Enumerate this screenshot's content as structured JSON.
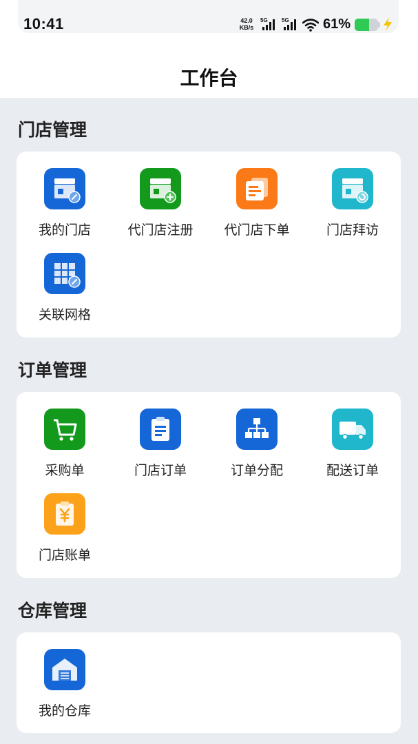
{
  "status_bar": {
    "time": "10:41",
    "net_speed_value": "42.0",
    "net_speed_unit": "KB/s",
    "sim1": "5G",
    "sim2": "5G",
    "battery_percent": "61%",
    "battery_level": 0.61
  },
  "header": {
    "title": "工作台"
  },
  "sections": [
    {
      "title": "门店管理",
      "items": [
        {
          "label": "我的门店",
          "icon": "store-link-icon",
          "color": "#1567d8"
        },
        {
          "label": "代门店注册",
          "icon": "store-add-icon",
          "color": "#139a1d"
        },
        {
          "label": "代门店下单",
          "icon": "documents-icon",
          "color": "#fb7a17"
        },
        {
          "label": "门店拜访",
          "icon": "store-visit-icon",
          "color": "#20b7cd"
        },
        {
          "label": "关联网格",
          "icon": "grid-link-icon",
          "color": "#1567d8"
        }
      ]
    },
    {
      "title": "订单管理",
      "items": [
        {
          "label": "采购单",
          "icon": "cart-icon",
          "color": "#139a1d"
        },
        {
          "label": "门店订单",
          "icon": "clipboard-icon",
          "color": "#1567d8"
        },
        {
          "label": "订单分配",
          "icon": "org-chart-icon",
          "color": "#1567d8"
        },
        {
          "label": "配送订单",
          "icon": "truck-icon",
          "color": "#20b7cd"
        },
        {
          "label": "门店账单",
          "icon": "bill-yen-icon",
          "color": "#fca21a"
        }
      ]
    },
    {
      "title": "仓库管理",
      "items": [
        {
          "label": "我的仓库",
          "icon": "warehouse-icon",
          "color": "#1567d8"
        }
      ]
    }
  ]
}
